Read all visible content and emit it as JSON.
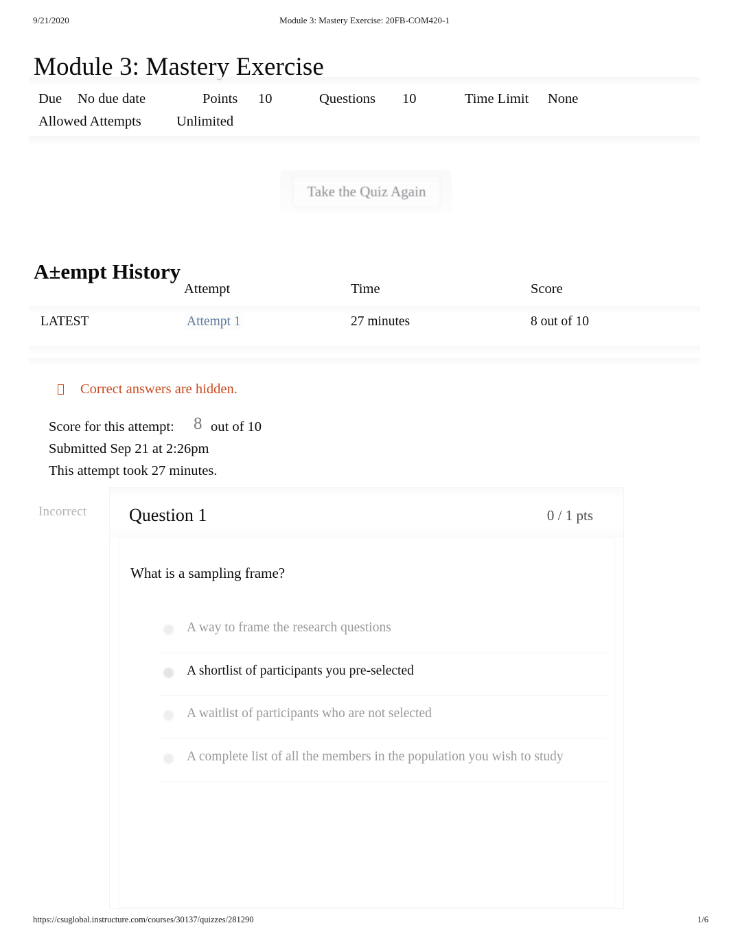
{
  "print": {
    "date": "9/21/2020",
    "doc_title": "Module 3: Mastery Exercise: 20FB-COM420-1",
    "footer_url": "https://csuglobal.instructure.com/courses/30137/quizzes/281290",
    "page_number": "1/6"
  },
  "page": {
    "title": "Module 3: Mastery Exercise"
  },
  "quiz_meta": {
    "due_label": "Due",
    "due_value": "No due date",
    "points_label": "Points",
    "points_value": "10",
    "questions_label": "Questions",
    "questions_value": "10",
    "time_limit_label": "Time Limit",
    "time_limit_value": "None",
    "allowed_attempts_label": "Allowed Attempts",
    "allowed_attempts_value": "Unlimited"
  },
  "actions": {
    "retake_label": "Take the Quiz Again"
  },
  "attempt_history": {
    "heading": "A±empt History",
    "columns": [
      "",
      "Attempt",
      "Time",
      "Score"
    ],
    "rows": [
      {
        "status": "LATEST",
        "attempt": "Attempt 1",
        "time": "27 minutes",
        "score": "8 out of 10"
      }
    ]
  },
  "notice": {
    "icon": "warning-icon",
    "text": "Correct answers are hidden."
  },
  "attempt_summary": {
    "score_label": "Score for this attempt:",
    "score_value": "8",
    "score_outof": "out of 10",
    "submitted": "Submitted Sep 21 at 2:26pm",
    "duration": "This attempt took 27 minutes."
  },
  "question": {
    "status": "Incorrect",
    "title": "Question 1",
    "points": "0 / 1 pts",
    "prompt": "What is a sampling frame?",
    "answers": [
      {
        "text": "A way to frame the research questions",
        "selected": false
      },
      {
        "text": "A shortlist of participants you pre-selected",
        "selected": true
      },
      {
        "text": "A waitlist of participants who are not selected",
        "selected": false
      },
      {
        "text": "A complete list of all the members in the population you wish to study",
        "selected": false
      }
    ]
  },
  "colors": {
    "notice": "#cb4b21",
    "link": "#5d7b9d",
    "muted": "#9a9a9c",
    "text": "#0a0a0a"
  }
}
